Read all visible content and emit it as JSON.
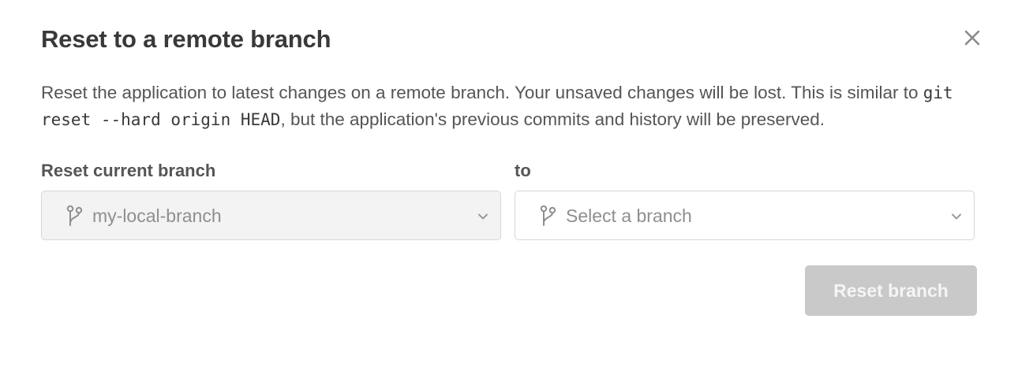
{
  "dialog": {
    "title": "Reset to a remote branch",
    "close_icon": "close-icon",
    "description": {
      "before_code": "Reset the application to latest changes on a remote branch. Your unsaved changes will be lost. This is similar to ",
      "code": "git reset --hard origin HEAD",
      "after_code": ", but the application's previous commits and history will be preserved."
    }
  },
  "form": {
    "current_branch": {
      "label": "Reset current branch",
      "value": "my-local-branch",
      "icon": "git-branch-icon",
      "disabled": true
    },
    "target_branch": {
      "label": "to",
      "placeholder": "Select a branch",
      "icon": "git-branch-icon"
    }
  },
  "actions": {
    "reset_label": "Reset branch",
    "reset_disabled": true
  },
  "colors": {
    "text_primary": "#393939",
    "text_secondary": "#555555",
    "disabled_fill": "#f3f3f3",
    "button_disabled_bg": "#c9c9c9",
    "border": "#d6d6d6"
  }
}
